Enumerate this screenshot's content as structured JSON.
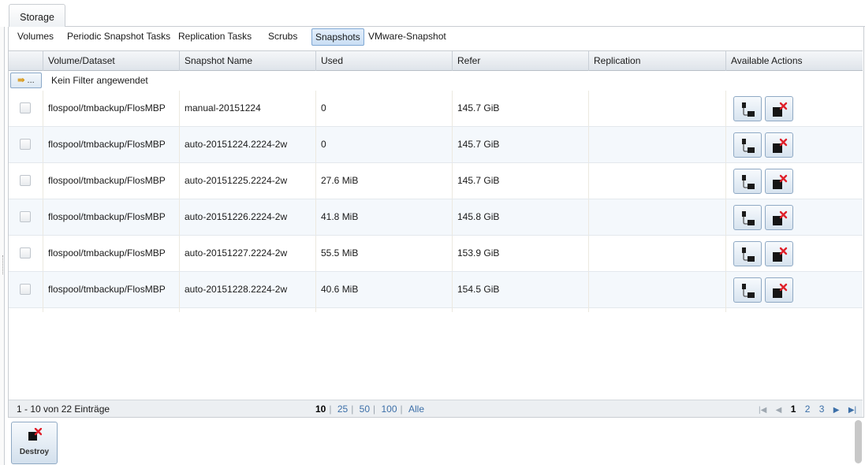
{
  "main_tab": {
    "label": "Storage"
  },
  "subtabs": [
    {
      "label": "Volumes"
    },
    {
      "label": "Periodic Snapshot Tasks"
    },
    {
      "label": "Replication Tasks"
    },
    {
      "label": "Scrubs"
    },
    {
      "label": "Snapshots"
    },
    {
      "label": "VMware-Snapshot"
    }
  ],
  "active_subtab": "Snapshots",
  "table": {
    "columns": [
      "Volume/Dataset",
      "Snapshot Name",
      "Used",
      "Refer",
      "Replication",
      "Available Actions"
    ],
    "filter_button_label": "...",
    "filter_text": "Kein Filter angewendet",
    "rows": [
      {
        "dataset": "flospool/tmbackup/FlosMBP",
        "snapshot": "manual-20151224",
        "used": "0",
        "refer": "145.7 GiB",
        "replication": ""
      },
      {
        "dataset": "flospool/tmbackup/FlosMBP",
        "snapshot": "auto-20151224.2224-2w",
        "used": "0",
        "refer": "145.7 GiB",
        "replication": ""
      },
      {
        "dataset": "flospool/tmbackup/FlosMBP",
        "snapshot": "auto-20151225.2224-2w",
        "used": "27.6 MiB",
        "refer": "145.7 GiB",
        "replication": ""
      },
      {
        "dataset": "flospool/tmbackup/FlosMBP",
        "snapshot": "auto-20151226.2224-2w",
        "used": "41.8 MiB",
        "refer": "145.8 GiB",
        "replication": ""
      },
      {
        "dataset": "flospool/tmbackup/FlosMBP",
        "snapshot": "auto-20151227.2224-2w",
        "used": "55.5 MiB",
        "refer": "153.9 GiB",
        "replication": ""
      },
      {
        "dataset": "flospool/tmbackup/FlosMBP",
        "snapshot": "auto-20151228.2224-2w",
        "used": "40.6 MiB",
        "refer": "154.5 GiB",
        "replication": ""
      }
    ]
  },
  "footer": {
    "count_text": "1 - 10 von 22 Einträge",
    "page_sizes": [
      "10",
      "25",
      "50",
      "100",
      "Alle"
    ],
    "current_page_size": "10",
    "pages": [
      "1",
      "2",
      "3"
    ],
    "current_page": "1"
  },
  "destroy_button": {
    "label": "Destroy"
  },
  "colors": {
    "accent_blue": "#3c6fa8",
    "delete_red": "#e0202a",
    "header_bg": "#dfe4ea"
  },
  "icons": {
    "clone": "clone-snapshot-icon",
    "destroy": "destroy-snapshot-icon",
    "filter": "filter-icon"
  }
}
